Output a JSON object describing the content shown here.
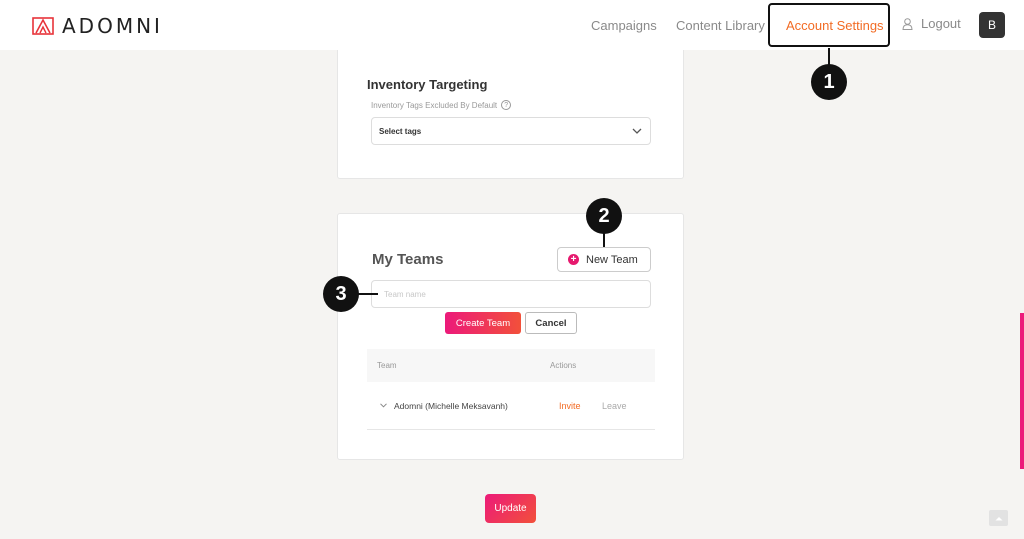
{
  "header": {
    "logo_text": "ADOMNI",
    "nav": {
      "campaigns": "Campaigns",
      "content_library": "Content Library",
      "account_settings": "Account Settings",
      "logout": "Logout"
    },
    "avatar_initial": "B",
    "active_color": "#f26b24"
  },
  "callouts": {
    "one": "1",
    "two": "2",
    "three": "3"
  },
  "inventory": {
    "title": "Inventory Targeting",
    "subtitle": "Inventory Tags Excluded By Default",
    "help_icon": "question-circle-icon",
    "select_value": "Select tags"
  },
  "teams": {
    "title": "My Teams",
    "new_team_label": "New Team",
    "input_placeholder": "Team name",
    "create_label": "Create Team",
    "cancel_label": "Cancel",
    "columns": {
      "team": "Team",
      "actions": "Actions"
    },
    "rows": [
      {
        "name": "Adomni (Michelle Meksavanh)",
        "invite": "Invite",
        "leave": "Leave"
      }
    ]
  },
  "update_label": "Update",
  "accent_gradient": [
    "#ec1a7a",
    "#f2503a"
  ]
}
